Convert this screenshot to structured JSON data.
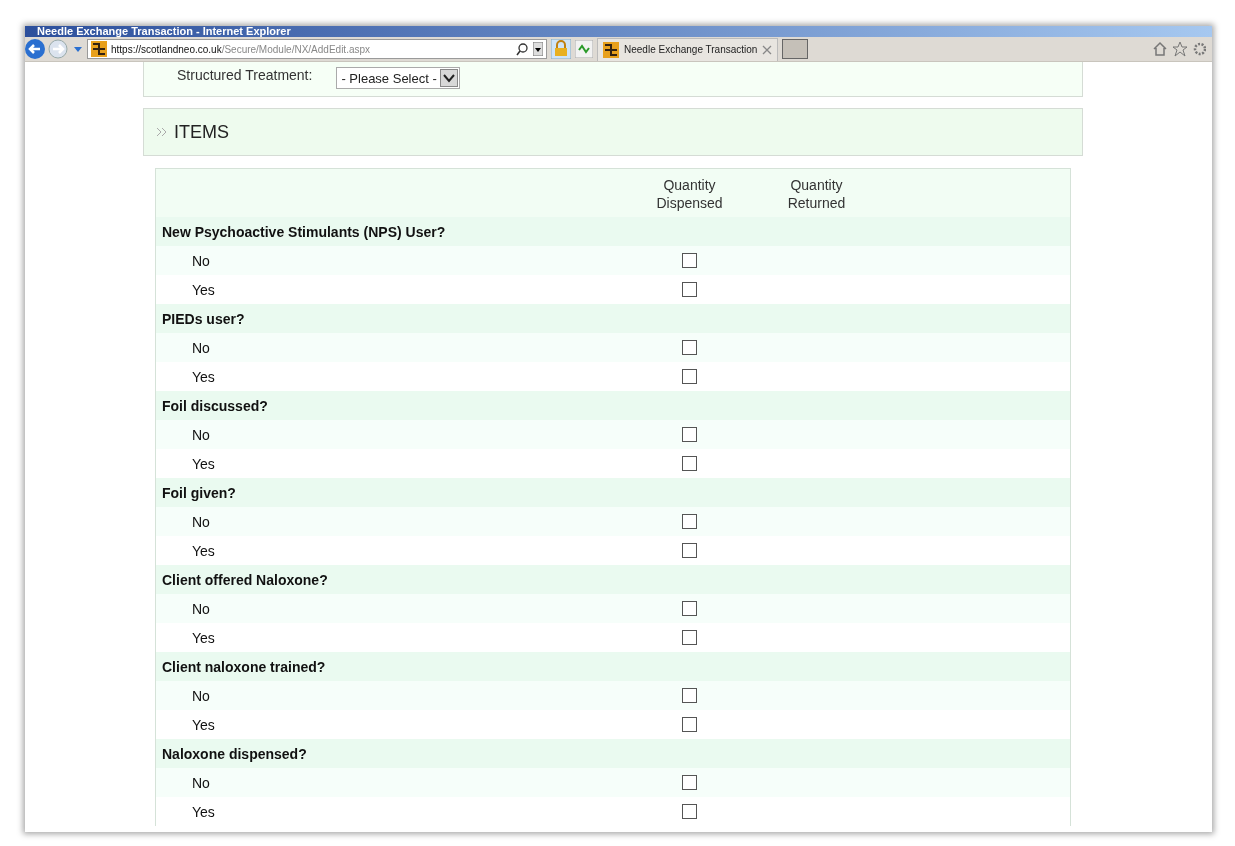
{
  "window": {
    "title": "Needle Exchange Transaction - Internet Explorer"
  },
  "address_bar": {
    "url_host": "https://scotlandneo.co.uk",
    "url_path": "/Secure/Module/NX/AddEdit.aspx"
  },
  "tabs": [
    {
      "label": "Needle Exchange Transaction",
      "selected": true
    }
  ],
  "form": {
    "structured_treatment": {
      "label": "Structured Treatment:",
      "value": "- Please Select -"
    }
  },
  "items": {
    "title": "ITEMS",
    "columns": [
      "Quantity\nDispensed",
      "Quantity\nReturned"
    ],
    "questions": [
      {
        "label": "New Psychoactive Stimulants (NPS) User?",
        "options": [
          {
            "label": "No",
            "checked": false
          },
          {
            "label": "Yes",
            "checked": false
          }
        ]
      },
      {
        "label": "PIEDs user?",
        "options": [
          {
            "label": "No",
            "checked": false
          },
          {
            "label": "Yes",
            "checked": false
          }
        ]
      },
      {
        "label": "Foil discussed?",
        "options": [
          {
            "label": "No",
            "checked": false
          },
          {
            "label": "Yes",
            "checked": false
          }
        ]
      },
      {
        "label": "Foil given?",
        "options": [
          {
            "label": "No",
            "checked": false
          },
          {
            "label": "Yes",
            "checked": false
          }
        ]
      },
      {
        "label": "Client offered Naloxone?",
        "options": [
          {
            "label": "No",
            "checked": false
          },
          {
            "label": "Yes",
            "checked": false
          }
        ]
      },
      {
        "label": "Client naloxone trained?",
        "options": [
          {
            "label": "No",
            "checked": false
          },
          {
            "label": "Yes",
            "checked": false
          }
        ]
      },
      {
        "label": "Naloxone dispensed?",
        "options": [
          {
            "label": "No",
            "checked": false
          },
          {
            "label": "Yes",
            "checked": false
          }
        ]
      }
    ]
  }
}
